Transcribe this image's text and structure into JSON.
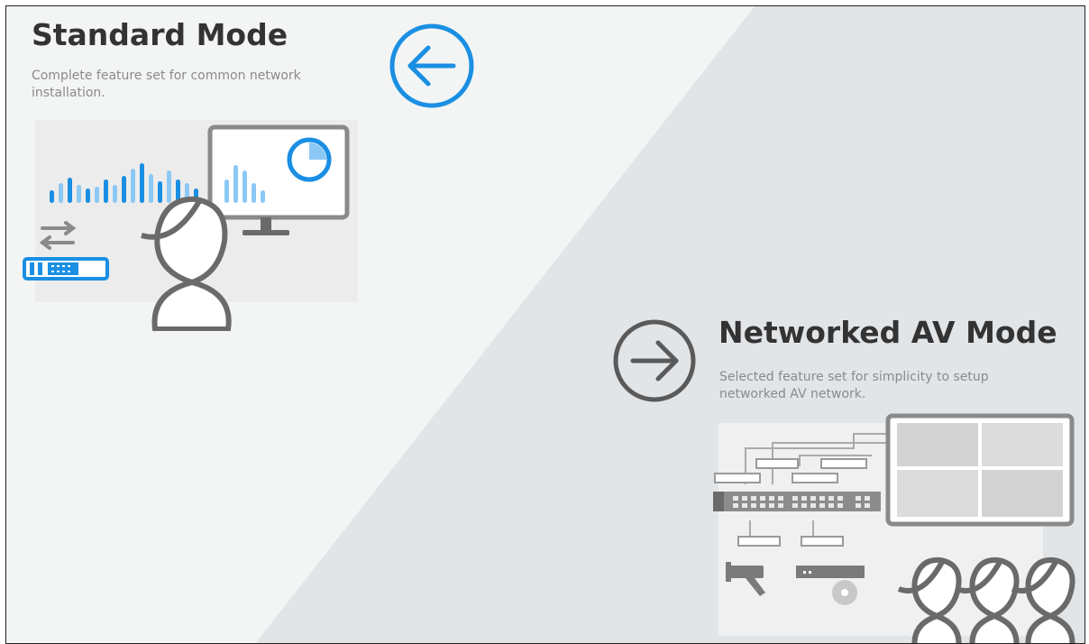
{
  "standard_mode": {
    "title": "Standard Mode",
    "description": "Complete feature set for common network installation.",
    "arrow_icon": "arrow-left-circle-icon",
    "illustration": "standard-mode-illustration"
  },
  "networked_av_mode": {
    "title": "Networked AV Mode",
    "description": "Selected feature set for simplicity to setup networked AV network.",
    "arrow_icon": "arrow-right-circle-icon",
    "illustration": "networked-av-mode-illustration"
  },
  "colors": {
    "accent_blue": "#1a8fe3",
    "light_blue": "#8cc8f5",
    "dark_gray": "#5a5a5a",
    "title_text": "#333333",
    "desc_text": "#8a8a8a",
    "left_bg": "#f3f5f5",
    "right_bg": "#e2e5e8"
  }
}
